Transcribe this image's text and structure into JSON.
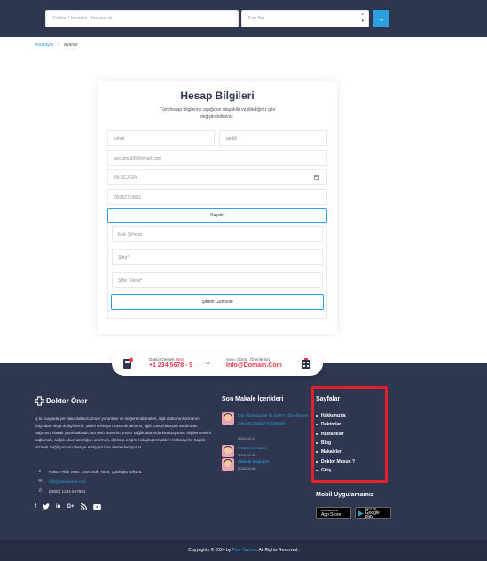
{
  "header": {
    "search_placeholder": "Doktor, Uzmanlık, Hastane ob",
    "city_select": "Tüm İller",
    "city_clear": "×",
    "city_caret": "▾",
    "go_icon": "→"
  },
  "breadcrumb": {
    "home": "Anasayfa",
    "separator": "›",
    "current": "Ayarlar"
  },
  "account": {
    "title": "Hesap Bilgileri",
    "subtitle": "Tüm hesap bilgilerine aşağıdan ulaşabilir ve dilediğiniz gibi değiştirebilirsiniz.",
    "first_name": "umut",
    "last_name": "gedik",
    "email": "ayoumut06@gmail.com",
    "birth_date": "06.02.2024",
    "phone": "05362703811",
    "save_label": "Kaydet",
    "old_password_placeholder": "Eski Şifreniz",
    "password_placeholder": "Şifre*",
    "password_repeat_placeholder": "Şifre Tekrar*",
    "update_password_label": "Şifreni Güncelle"
  },
  "contact_pill": {
    "doctor_label_prefix": "Doktor Destek",
    "doctor_label_highlight": "Hattı",
    "doctor_phone": "+1 234 5678 - 9",
    "conjunction": "- ve -",
    "feedback_label": "Soru, Görüş, Önerileriniz",
    "feedback_email": "Info@Domain.Com"
  },
  "footer": {
    "logo_text": "Doktor Öner",
    "about": "İş bu sayfada yer alan doktor/uzman yorumları ve değerlendirmeleri, ilgili doktorun/uzmanın doğrudan veya dolaylı emri, talebi ve/veya ricası olmaksızın, ilgili hasta/danışan tarafından bağımsız olarak yazılmaktadır. Bu web sitesinin amacı sağlık alanında kamuoyunun bilgilenmesini sağlamak, sağlık okuryazarlığını artırmak, doktora erişimi kolaylaştırmaktır. Herhangi bir Sağlık Hizmeti Sağlayıcısını tavsiye etmiyoruz ve desteklemiyoruz.",
    "address": "Rasuh Akar Mah. 1405 Sok. No:5, Çankaya Ankara",
    "email": "info@domainurl.com",
    "phone": "(0800) 1234 567891",
    "social": [
      "f",
      "t",
      "in",
      "G+",
      "rss",
      "yt"
    ],
    "articles_title": "Son Makale İçerikleri",
    "articles": [
      {
        "title": "Diş Ağrısına Ne İyi Gelir? Diş Ağrısını Geçiren Doğal Yöntemler",
        "date": "2024-02-11"
      },
      {
        "title": "Örümcek Adam",
        "date": "2024-02-08"
      },
      {
        "title": "Makale Başlığım",
        "date": "2024-02-08"
      }
    ],
    "pages_title": "Sayfalar",
    "pages": [
      "Hakkımızda",
      "Doktorlar",
      "Hastaneler",
      "Blog",
      "Makaleler",
      "Doktor Musun ?",
      "Giriş"
    ],
    "mobile_title": "Mobil Uygulamamız",
    "appstore_small": "Download on the",
    "appstore_big": "App Store",
    "gplay_small": "GET IT ON",
    "gplay_big": "Google play",
    "copyright_prefix": "Copyrights © 2024 by",
    "copyright_brand": "Pixa Yazılım",
    "copyright_suffix": ". All Rights Reserved."
  },
  "colors": {
    "navy": "#2f3650",
    "accent": "#2d9ee0",
    "red": "#e8394d",
    "highlight_box": "#e4202e"
  }
}
